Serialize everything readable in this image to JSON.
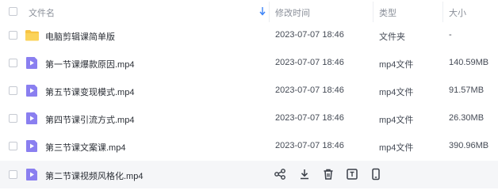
{
  "header": {
    "name_label": "文件名",
    "mtime_label": "修改时间",
    "type_label": "类型",
    "size_label": "大小"
  },
  "colors": {
    "folder": "#f7c443",
    "video": "#8a7ff0",
    "accent": "#3b82f6"
  },
  "rows": [
    {
      "name": "电脑剪辑课简单版",
      "mtime": "2023-07-07 18:46",
      "type": "文件夹",
      "size": "-",
      "icon": "folder-icon"
    },
    {
      "name": "第一节课爆款原因.mp4",
      "mtime": "2023-07-07 18:46",
      "type": "mp4文件",
      "size": "140.59MB",
      "icon": "video-file-icon"
    },
    {
      "name": "第五节课变现模式.mp4",
      "mtime": "2023-07-07 18:46",
      "type": "mp4文件",
      "size": "91.57MB",
      "icon": "video-file-icon"
    },
    {
      "name": "第四节课引流方式.mp4",
      "mtime": "2023-07-07 18:46",
      "type": "mp4文件",
      "size": "26.30MB",
      "icon": "video-file-icon"
    },
    {
      "name": "第三节课文案课.mp4",
      "mtime": "2023-07-07 18:46",
      "type": "mp4文件",
      "size": "390.96MB",
      "icon": "video-file-icon"
    },
    {
      "name": "第二节课视频风格化.mp4",
      "mtime": "",
      "type": "",
      "size": "",
      "icon": "video-file-icon",
      "hover_actions": [
        "share-icon",
        "download-icon",
        "delete-icon",
        "text-icon",
        "mobile-icon"
      ]
    }
  ]
}
